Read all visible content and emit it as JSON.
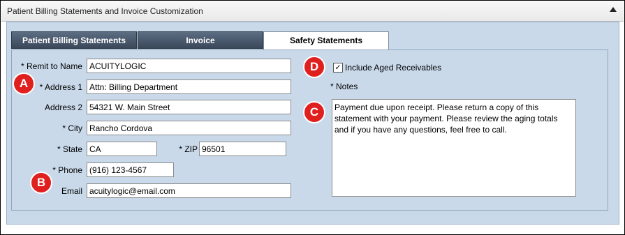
{
  "window": {
    "title": "Patient Billing Statements and Invoice Customization"
  },
  "tabs": [
    {
      "label": "Patient Billing Statements",
      "active": false
    },
    {
      "label": "Invoice",
      "active": false
    },
    {
      "label": "Safety Statements",
      "active": true
    }
  ],
  "form": {
    "remit_to_name": {
      "label": "* Remit to Name",
      "value": "ACUITYLOGIC"
    },
    "address1": {
      "label": "* Address 1",
      "value": "Attn: Billing Department"
    },
    "address2": {
      "label": "Address 2",
      "value": "54321 W. Main Street"
    },
    "city": {
      "label": "* City",
      "value": "Rancho Cordova"
    },
    "state": {
      "label": "* State",
      "value": "CA"
    },
    "zip": {
      "label": "* ZIP",
      "value": "96501"
    },
    "phone": {
      "label": "* Phone",
      "value": "(916) 123-4567"
    },
    "email": {
      "label": "Email",
      "value": "acuitylogic@email.com"
    },
    "include_aged": {
      "label": "Include Aged Receivables",
      "checked": true,
      "mark": "✓"
    },
    "notes": {
      "label": "* Notes",
      "value": "Payment due upon receipt. Please return a copy of this statement with your payment. Please review the aging totals and if you have any questions, feel free to call."
    }
  },
  "markers": {
    "a": "A",
    "b": "B",
    "c": "C",
    "d": "D"
  },
  "colors": {
    "marker": "#e01f1f",
    "panel": "#c9d9ea",
    "tab_inactive": "#3a485a"
  }
}
